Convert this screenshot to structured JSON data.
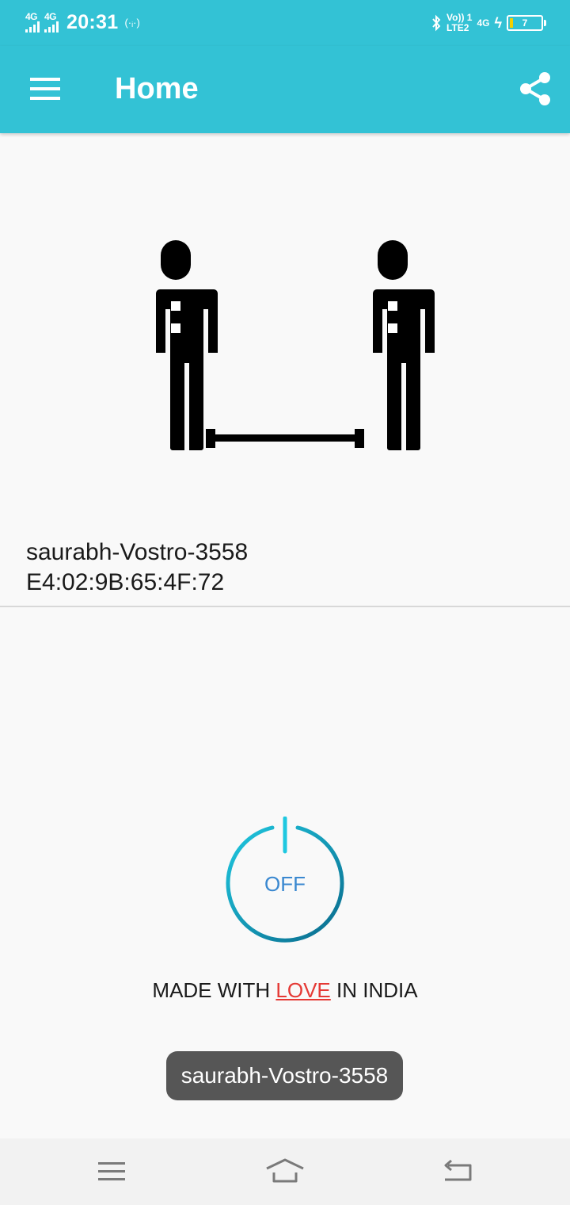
{
  "status_bar": {
    "sim1_network": "4G",
    "sim2_network": "4G",
    "time": "20:31",
    "hotspot_icon": "hotspot-icon",
    "bluetooth_icon": "bluetooth-icon",
    "volte_top": "Vo)) 1",
    "volte_bottom": "LTE2",
    "data_network": "4G",
    "battery_level": "7"
  },
  "app_bar": {
    "title": "Home",
    "menu_icon": "menu-icon",
    "share_icon": "share-icon",
    "color": "#33c2d5"
  },
  "device": {
    "name": "saurabh-Vostro-3558",
    "mac": "E4:02:9B:65:4F:72"
  },
  "power_button": {
    "label": "OFF",
    "ring_color_start": "#1fc8e0",
    "ring_color_end": "#0a6a8c"
  },
  "footer": {
    "made_prefix": "MADE WITH",
    "love": "LOVE",
    "made_suffix": "IN INDIA"
  },
  "toast": {
    "text": "saurabh-Vostro-3558"
  },
  "nav_bar": {
    "recents_icon": "recents-icon",
    "home_icon": "home-icon",
    "back_icon": "back-icon"
  }
}
